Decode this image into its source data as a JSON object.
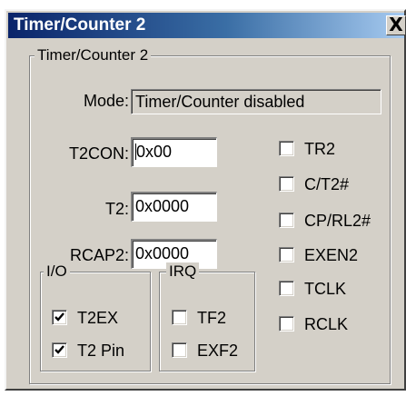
{
  "window": {
    "title": "Timer/Counter 2",
    "close_label": "X"
  },
  "group_main": {
    "legend": "Timer/Counter 2"
  },
  "mode": {
    "label": "Mode:",
    "value": "Timer/Counter disabled"
  },
  "registers": {
    "t2con": {
      "label": "T2CON:",
      "value": "0x00"
    },
    "t2": {
      "label": "T2:",
      "value": "0x0000"
    },
    "rcap2": {
      "label": "RCAP2:",
      "value": "0x0000"
    }
  },
  "io_group": {
    "legend": "I/O",
    "items": [
      {
        "label": "T2EX",
        "checked": true
      },
      {
        "label": "T2 Pin",
        "checked": true
      }
    ]
  },
  "irq_group": {
    "legend": "IRQ",
    "items": [
      {
        "label": "TF2",
        "checked": false
      },
      {
        "label": "EXF2",
        "checked": false
      }
    ]
  },
  "control_bits": [
    {
      "label": "TR2",
      "checked": false
    },
    {
      "label": "C/T2#",
      "checked": false
    },
    {
      "label": "CP/RL2#",
      "checked": false
    },
    {
      "label": "EXEN2",
      "checked": false
    },
    {
      "label": "TCLK",
      "checked": false
    },
    {
      "label": "RCLK",
      "checked": false
    }
  ],
  "colors": {
    "dialog_face": "#d4d0c8",
    "title_active_start": "#0a246a",
    "title_active_end": "#a6caf0"
  }
}
